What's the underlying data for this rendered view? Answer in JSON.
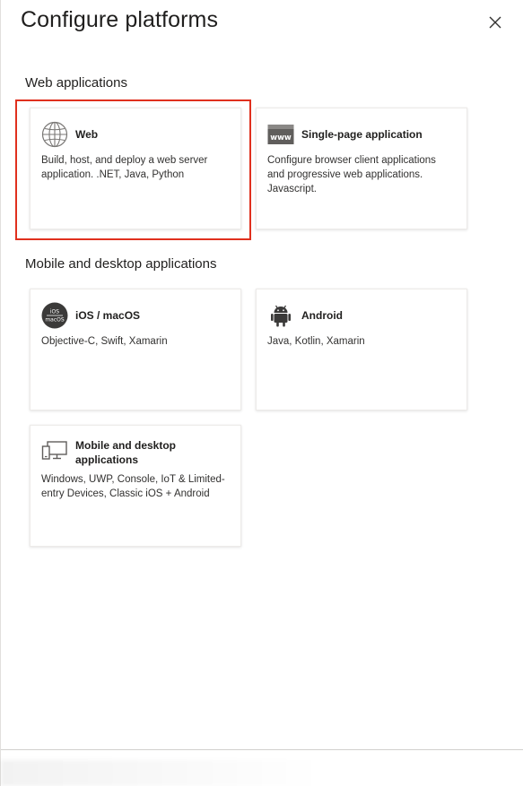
{
  "panel": {
    "title": "Configure platforms",
    "close_icon": "close-icon"
  },
  "sections": [
    {
      "heading": "Web applications",
      "cards": [
        {
          "title": "Web",
          "icon": "globe-icon",
          "description": "Build, host, and deploy a web server application. .NET, Java, Python",
          "highlighted": true
        },
        {
          "title": "Single-page application",
          "icon": "www-icon",
          "description": "Configure browser client applications and progressive web applications. Javascript."
        }
      ]
    },
    {
      "heading": "Mobile and desktop applications",
      "cards": [
        {
          "title": "iOS / macOS",
          "icon": "ios-macos-icon",
          "icon_text_top": "iOS",
          "icon_text_bottom": "macOS",
          "description": "Objective-C, Swift, Xamarin"
        },
        {
          "title": "Android",
          "icon": "android-icon",
          "description": "Java, Kotlin, Xamarin"
        },
        {
          "title": "Mobile and desktop applications",
          "icon": "desktop-icon",
          "description": "Windows, UWP, Console, IoT & Limited-entry Devices, Classic iOS + Android"
        }
      ]
    }
  ],
  "colors": {
    "highlight_border": "#e0301e",
    "card_border": "#edebe9"
  }
}
